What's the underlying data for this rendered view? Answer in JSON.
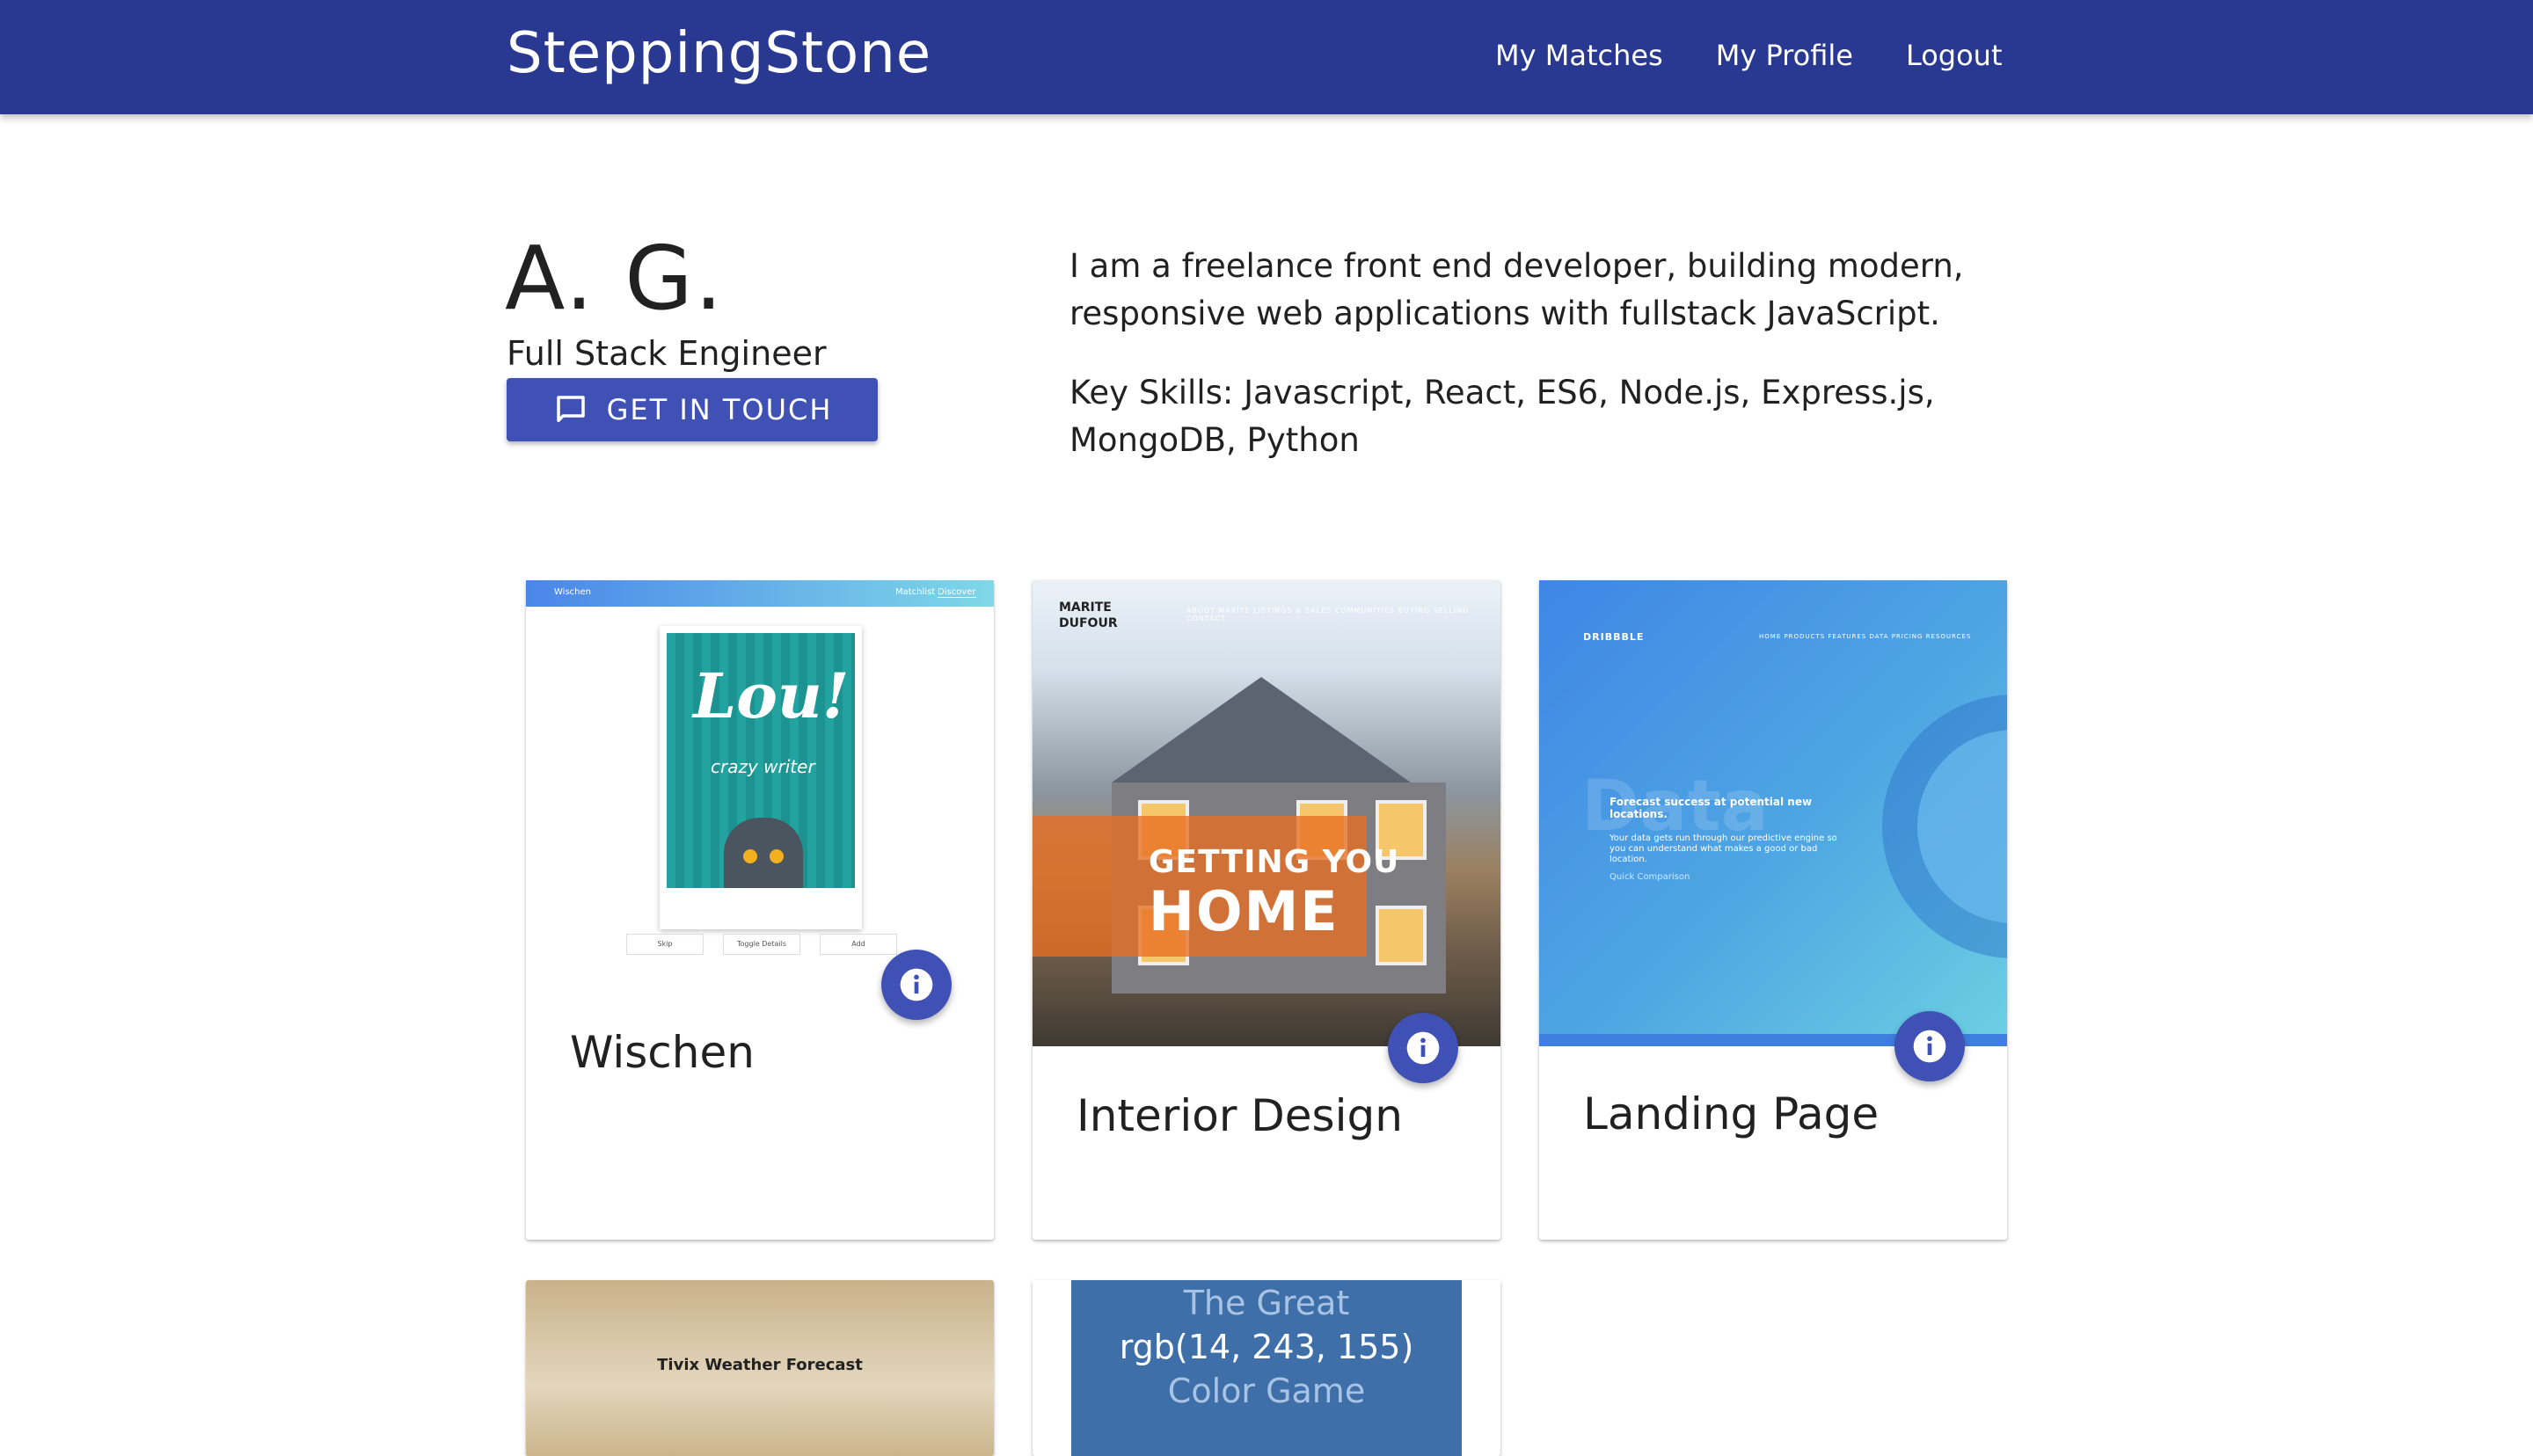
{
  "navbar": {
    "brand": "SteppingStone",
    "links": [
      "My Matches",
      "My Profile",
      "Logout"
    ]
  },
  "profile": {
    "name": "A. G.",
    "title": "Full Stack Engineer",
    "contact_button": "GET IN TOUCH",
    "bio": [
      "I am a freelance front end developer, building modern, responsive web applications with fullstack JavaScript.",
      "Key Skills: Javascript, React, ES6, Node.js, Express.js, MongoDB, Python"
    ]
  },
  "projects": [
    {
      "title": "Wischen",
      "thumb": {
        "brand": "Wischen",
        "menu": [
          "Matchlist",
          "Discover"
        ],
        "poster_title": "Lou!",
        "poster_subtitle": "crazy writer",
        "buttons": [
          "Skip",
          "Toggle Details",
          "Add"
        ]
      }
    },
    {
      "title": "Interior Design",
      "thumb": {
        "logo_line1": "MARITE",
        "logo_line2": "DUFOUR",
        "menu": "ABOUT MARITE   LISTINGS & SALES   COMMUNITIES   BUYING   SELLING   CONTACT",
        "headline_small": "GETTING YOU",
        "headline_big": "HOME"
      }
    },
    {
      "title": "Landing Page",
      "thumb": {
        "brand": "DRIBBBLE",
        "menu": "HOME   PRODUCTS   FEATURES   DATA   PRICING   RESOURCES",
        "bg_word": "Data",
        "heading": "Forecast success at potential new locations.",
        "body": "Your data gets run through our predictive engine so you can understand what makes a good or bad location.",
        "link": "Quick Comparison"
      }
    },
    {
      "title": "",
      "thumb": {
        "text": "Tivix Weather Forecast"
      }
    },
    {
      "title": "",
      "thumb": {
        "line1": "The Great",
        "line2": "rgb(14, 243, 155)",
        "line3": "Color Game"
      }
    }
  ],
  "colors": {
    "navbar": "#293992",
    "primary": "#3f51b5",
    "text": "#212121"
  },
  "icons": {
    "contact": "chat-bubble-icon",
    "info": "info-icon"
  }
}
